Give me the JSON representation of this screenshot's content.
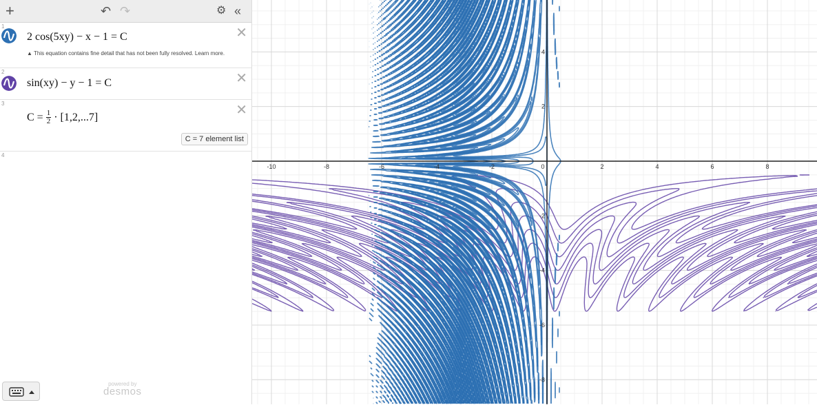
{
  "toolbar": {
    "add_icon": "plus-icon",
    "undo_icon": "undo-icon",
    "redo_icon": "redo-icon",
    "settings_icon": "gear-icon",
    "collapse_icon": "double-chevron-left-icon"
  },
  "expressions": [
    {
      "num": "1",
      "color": "#2d70b3",
      "latex_left": "2 cos(5xy) − x − 1 = C",
      "warning": "▲ This equation contains fine detail that has not been fully resolved. Learn more."
    },
    {
      "num": "2",
      "color": "#6042a6",
      "latex_left": "sin(xy) − y − 1 = C"
    },
    {
      "num": "3",
      "prefix": "C =",
      "frac_num": "1",
      "frac_den": "2",
      "suffix": "· [1,2,...7]",
      "badge": "C  =  7 element list"
    },
    {
      "num": "4"
    }
  ],
  "footer": {
    "powered_by": "powered by",
    "brand": "desmos"
  },
  "graph": {
    "x_ticks": [
      "-10",
      "-8",
      "-6",
      "-4",
      "-2",
      "0",
      "2",
      "4",
      "6",
      "8"
    ],
    "y_ticks": [
      "4",
      "2",
      "-2",
      "-4",
      "-6",
      "-8"
    ],
    "x_range": [
      -10.7,
      9.8
    ],
    "y_range": [
      -8.9,
      5.9
    ],
    "curve_colors": [
      "#2d70b3",
      "#6042a6"
    ]
  }
}
